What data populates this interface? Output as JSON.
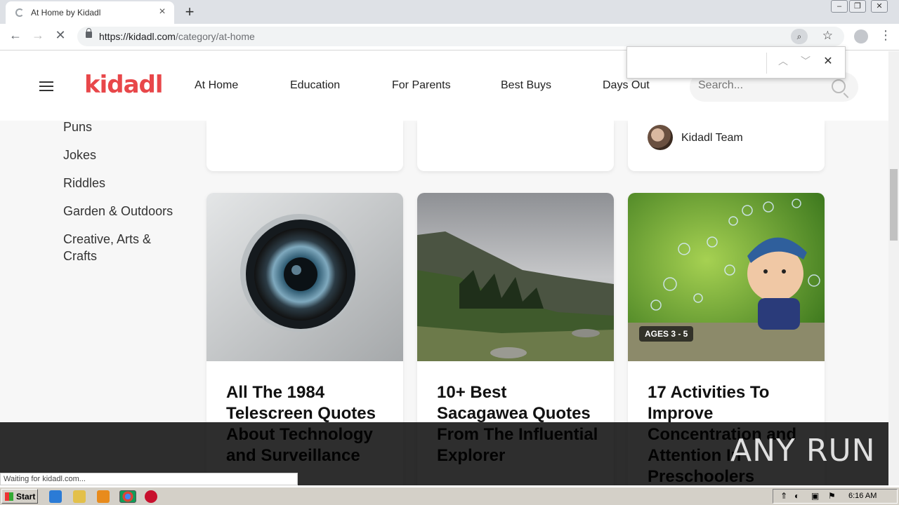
{
  "browser": {
    "tab_title": "At Home by Kidadl",
    "tab_close": "×",
    "new_tab": "+",
    "url_host": "https://kidadl.com",
    "url_path": "/category/at-home",
    "status_text": "Waiting for kidadl.com..."
  },
  "site": {
    "logo": "kidadl",
    "nav": [
      "At Home",
      "Education",
      "For Parents",
      "Best Buys",
      "Days Out"
    ],
    "search_placeholder": "Search..."
  },
  "sidebar": {
    "categories": [
      "Puns",
      "Jokes",
      "Riddles",
      "Garden & Outdoors",
      "Creative, Arts & Crafts"
    ]
  },
  "author": {
    "name": "Kidadl Team"
  },
  "cards": [
    {
      "title": "All The 1984 Telescreen Quotes About Technology and Surveillance",
      "image": "camera-lens"
    },
    {
      "title": "10+ Best Sacagawea Quotes From The Influential Explorer",
      "image": "mountain-landscape"
    },
    {
      "title": "17 Activities To Improve Concentration and Attention In Preschoolers",
      "image": "child-bubbles",
      "badge": "AGES 3 - 5"
    }
  ],
  "watermark": "ANY RUN",
  "taskbar": {
    "start_label": "Start",
    "clock": "6:16 AM"
  },
  "colors": {
    "brand": "#e8474a",
    "overlay": "#000000"
  }
}
